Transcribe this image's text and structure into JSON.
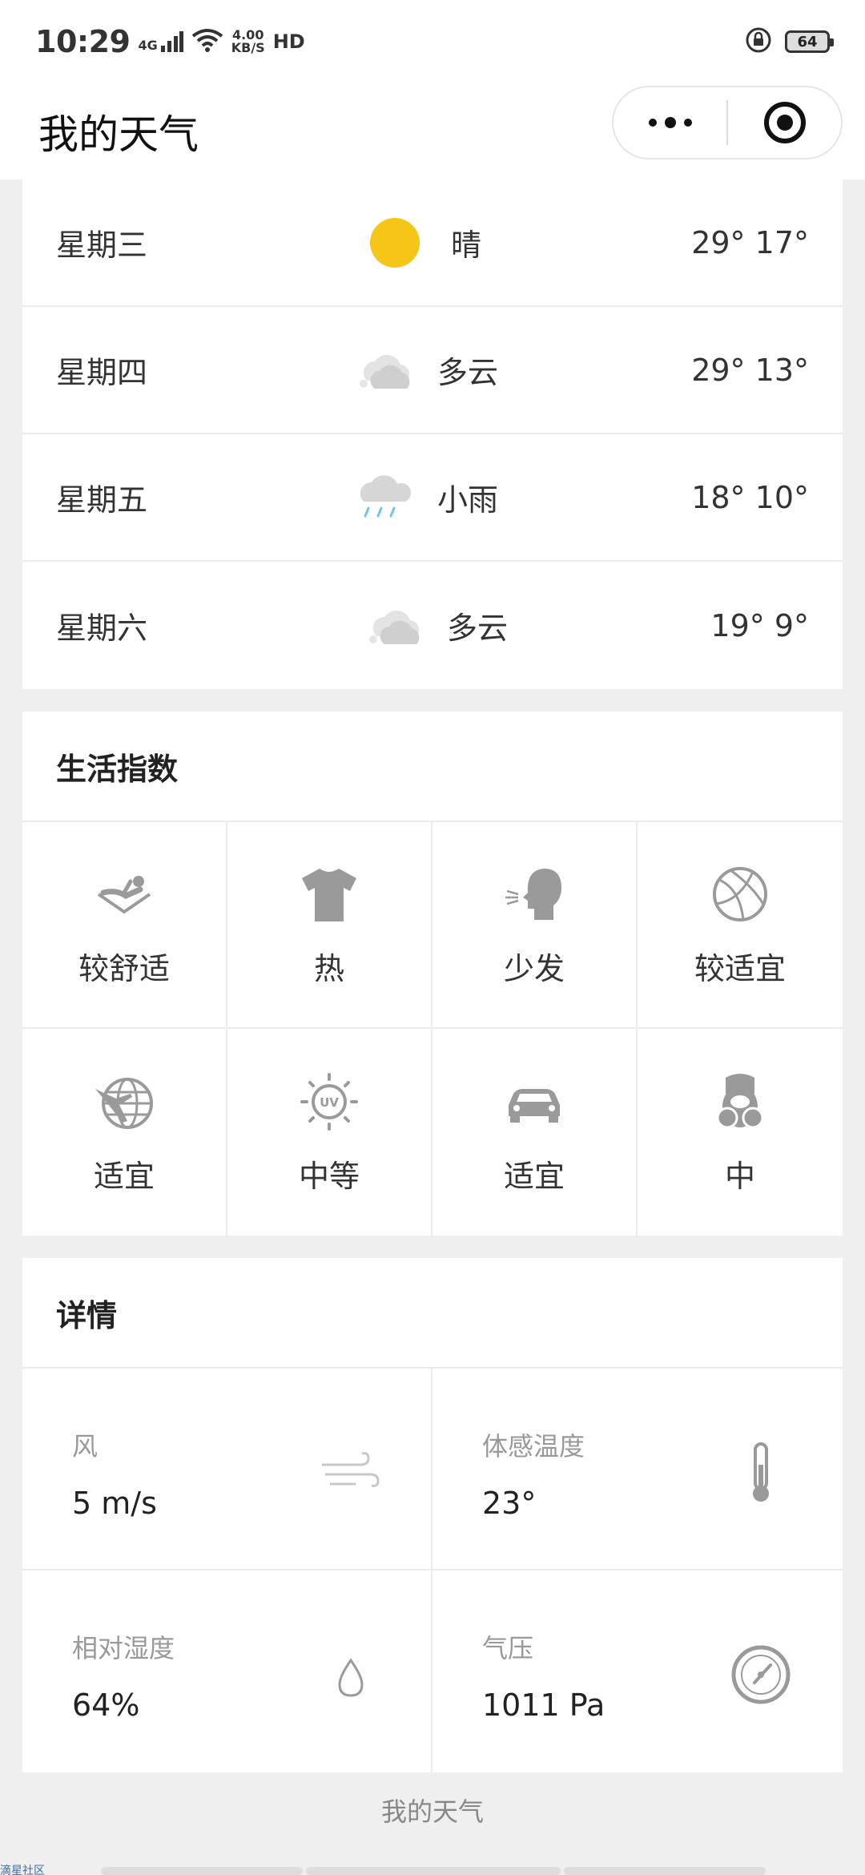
{
  "status": {
    "time": "10:29",
    "signal_label": "4G",
    "speed_value": "4.00",
    "speed_unit": "KB/S",
    "hd_label": "HD",
    "battery": "64"
  },
  "header": {
    "title": "我的天气"
  },
  "forecast": [
    {
      "day": "星期三",
      "condition": "晴",
      "icon": "sun-icon",
      "temps": "29° 17°"
    },
    {
      "day": "星期四",
      "condition": "多云",
      "icon": "cloud-icon",
      "temps": "29° 13°"
    },
    {
      "day": "星期五",
      "condition": "小雨",
      "icon": "light-rain-icon",
      "temps": "18° 10°"
    },
    {
      "day": "星期六",
      "condition": "多云",
      "icon": "cloud-icon",
      "temps": "19° 9°"
    }
  ],
  "life_index": {
    "title": "生活指数",
    "items": [
      {
        "label": "较舒适",
        "icon": "comfort-icon"
      },
      {
        "label": "热",
        "icon": "tshirt-icon"
      },
      {
        "label": "少发",
        "icon": "cold-sneeze-icon"
      },
      {
        "label": "较适宜",
        "icon": "basketball-icon"
      },
      {
        "label": "适宜",
        "icon": "travel-globe-icon"
      },
      {
        "label": "中等",
        "icon": "uv-icon"
      },
      {
        "label": "适宜",
        "icon": "car-wash-icon"
      },
      {
        "label": "中",
        "icon": "mask-icon"
      }
    ]
  },
  "details": {
    "title": "详情",
    "items": [
      {
        "label": "风",
        "value": "5 m/s",
        "icon": "wind-icon"
      },
      {
        "label": "体感温度",
        "value": "23°",
        "icon": "thermometer-icon"
      },
      {
        "label": "相对湿度",
        "value": "64%",
        "icon": "droplet-icon"
      },
      {
        "label": "气压",
        "value": "1011 Pa",
        "icon": "gauge-icon"
      }
    ]
  },
  "footer": {
    "text": "我的天气",
    "community": "滴星社区"
  },
  "colors": {
    "sun": "#f5c518",
    "icon_gray": "#9a9a9a",
    "rain": "#6ec6f0"
  }
}
